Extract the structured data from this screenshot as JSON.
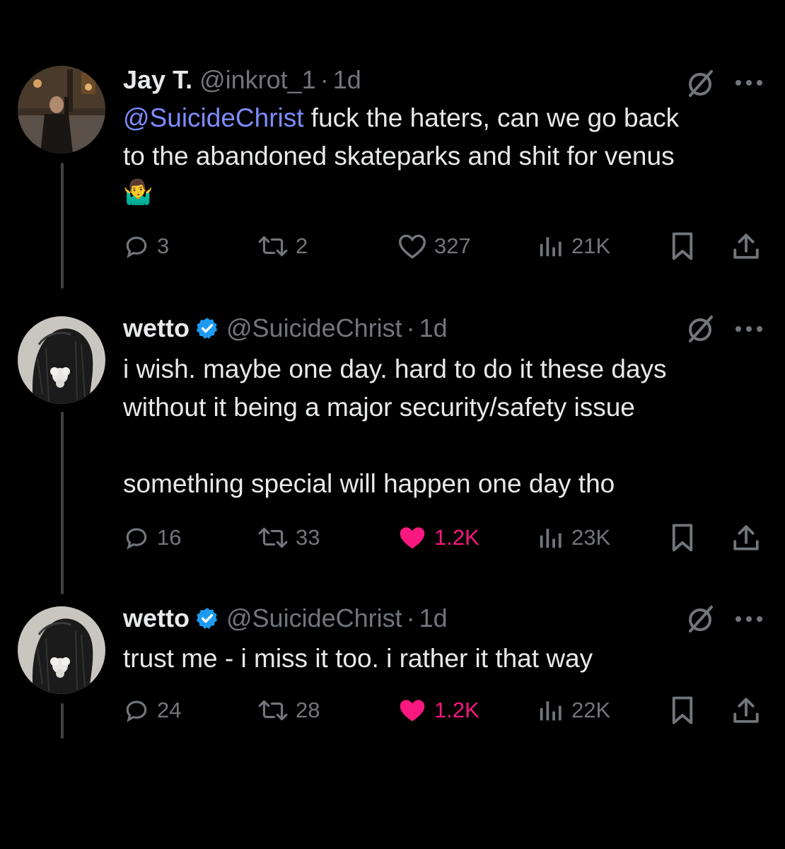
{
  "tweets": [
    {
      "name": "Jay T.",
      "handle": "@inkrot_1",
      "time": "1d",
      "verified": false,
      "mention": "@SuicideChrist",
      "text_line1_rest": " fuck the haters, can we go back",
      "text_line2": "to the abandoned skateparks and shit for venus",
      "emoji": "🤷‍♂️",
      "replies": "3",
      "reposts": "2",
      "likes": "327",
      "views": "21K",
      "liked": false
    },
    {
      "name": "wetto",
      "handle": "@SuicideChrist",
      "time": "1d",
      "verified": true,
      "text": "i wish. maybe one day. hard to do it these days\nwithout it being a major security/safety issue\n\nsomething special will happen one day tho",
      "replies": "16",
      "reposts": "33",
      "likes": "1.2K",
      "views": "23K",
      "liked": true
    },
    {
      "name": "wetto",
      "handle": "@SuicideChrist",
      "time": "1d",
      "verified": true,
      "text": "trust me - i miss it too. i rather it that way",
      "replies": "24",
      "reposts": "28",
      "likes": "1.2K",
      "views": "22K",
      "liked": true
    }
  ],
  "colors": {
    "background": "#000000",
    "text": "#e7e9ea",
    "secondary": "#71767b",
    "mention": "#7d8cff",
    "like": "#f91880",
    "verified": "#1d9bf0"
  }
}
